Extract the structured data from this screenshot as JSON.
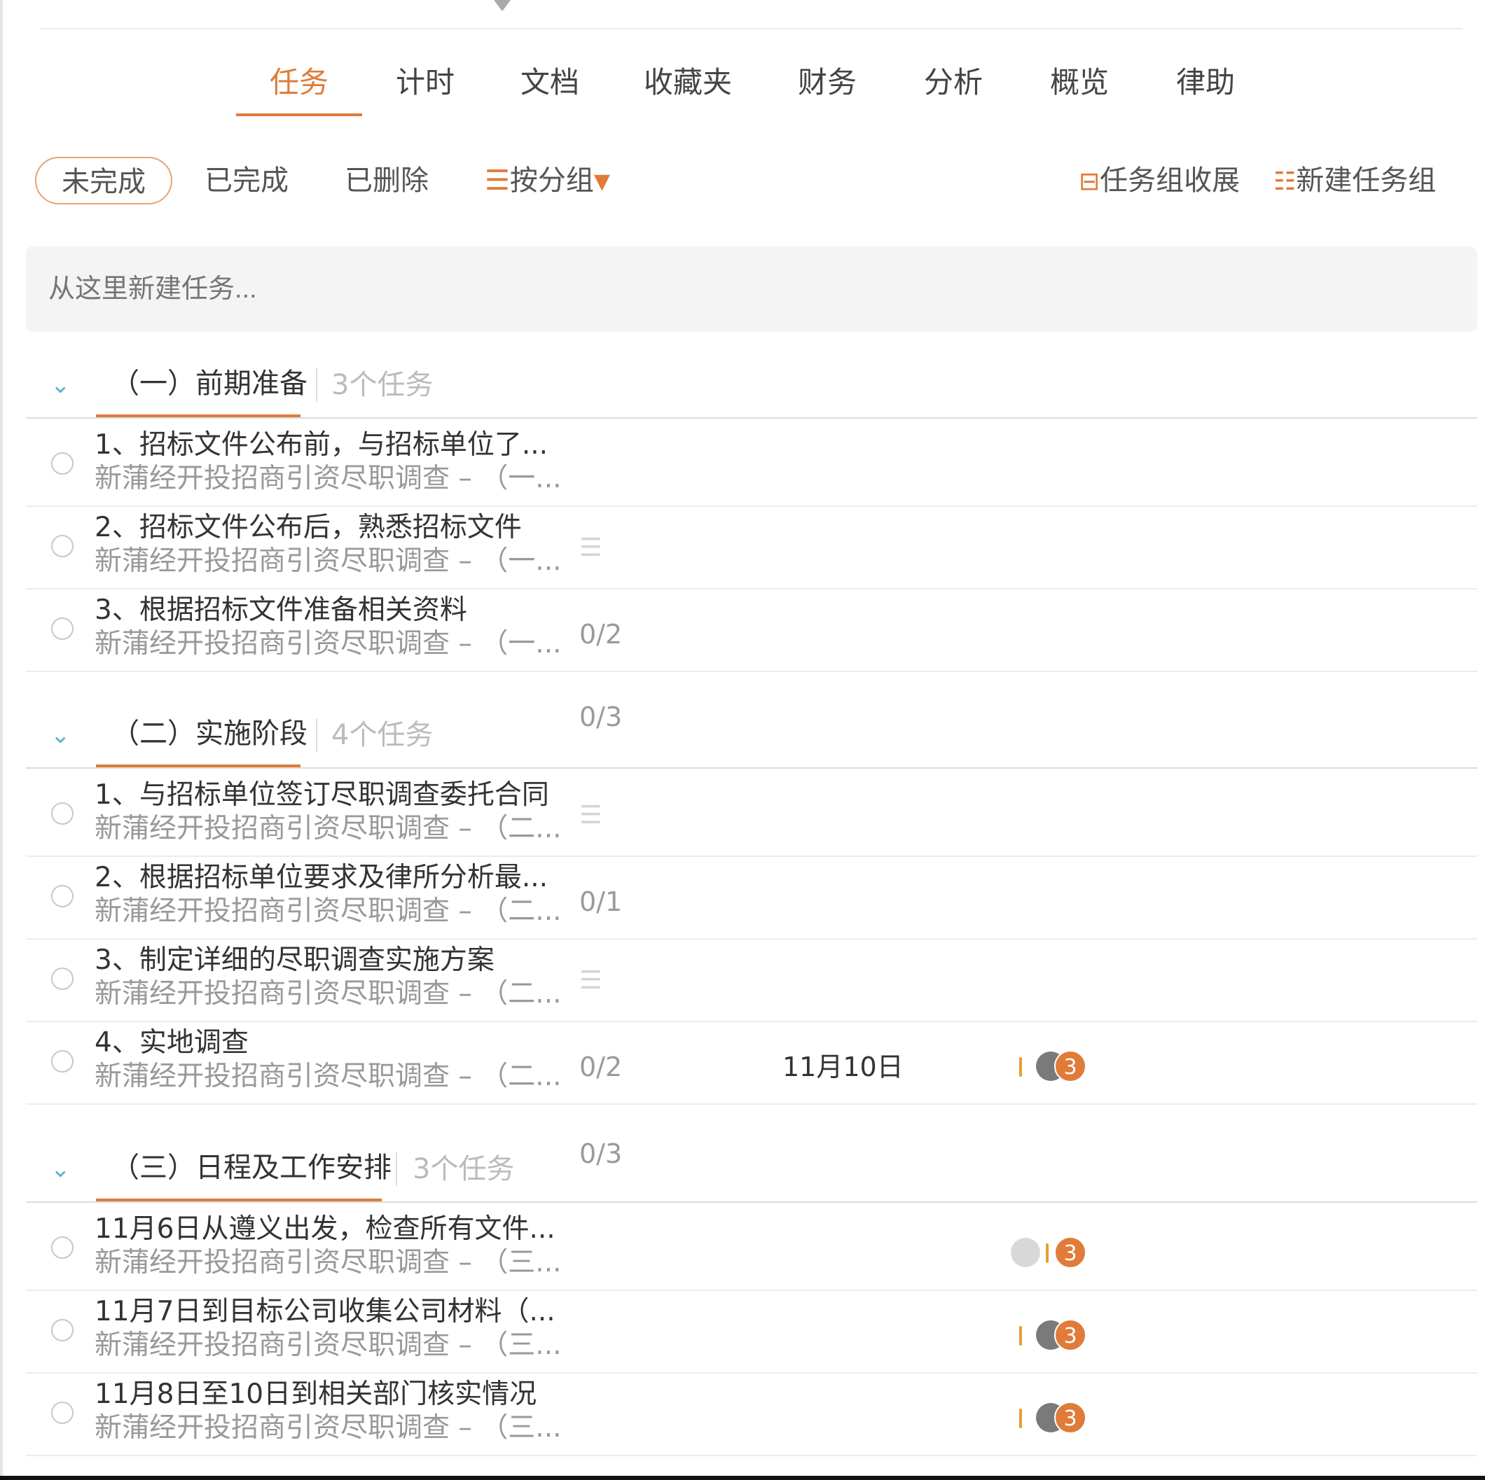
{
  "tabs": {
    "items": [
      "任务",
      "计时",
      "文档",
      "收藏夹",
      "财务",
      "分析",
      "概览",
      "律助"
    ]
  },
  "filters": {
    "incomplete": "未完成",
    "completed": "已完成",
    "deleted": "已删除",
    "group_by": "按分组",
    "collapse_groups": "任务组收展",
    "new_group": "新建任务组"
  },
  "new_task": {
    "placeholder": "从这里新建任务..."
  },
  "groups": [
    {
      "title": "（一）前期准备",
      "count": "3个任务",
      "tasks": [
        {
          "title": "1、招标文件公布前，与招标单位了...",
          "sub": "新蒲经开投招商引资尽职调查 – （一..."
        },
        {
          "title": "2、招标文件公布后，熟悉招标文件",
          "sub": "新蒲经开投招商引资尽职调查 – （一..."
        },
        {
          "title": "3、根据招标文件准备相关资料",
          "sub": "新蒲经开投招商引资尽职调查 – （一...",
          "subtasks": "0/2"
        }
      ]
    },
    {
      "title": "（二）实施阶段",
      "count": "4个任务",
      "header_subtasks": "0/3",
      "tasks": [
        {
          "title": "1、与招标单位签订尽职调查委托合同",
          "sub": "新蒲经开投招商引资尽职调查 – （二..."
        },
        {
          "title": "2、根据招标单位要求及律所分析最...",
          "sub": "新蒲经开投招商引资尽职调查 – （二...",
          "subtasks": "0/1"
        },
        {
          "title": "3、制定详细的尽职调查实施方案",
          "sub": "新蒲经开投招商引资尽职调查 – （二..."
        },
        {
          "title": "4、实地调查",
          "sub": "新蒲经开投招商引资尽职调查 – （二...",
          "subtasks": "0/2",
          "date": "11月10日",
          "badge": "3"
        }
      ]
    },
    {
      "title": "（三）日程及工作安排",
      "count": "3个任务",
      "header_subtasks": "0/3",
      "tasks": [
        {
          "title": "11月6日从遵义出发，检查所有文件...",
          "sub": "新蒲经开投招商引资尽职调查 – （三...",
          "badge": "3"
        },
        {
          "title": "11月7日到目标公司收集公司材料（...",
          "sub": "新蒲经开投招商引资尽职调查 – （三...",
          "badge": "3"
        },
        {
          "title": "11月8日至10日到相关部门核实情况",
          "sub": "新蒲经开投招商引资尽职调查 – （三...",
          "badge": "3"
        }
      ]
    }
  ],
  "colors": {
    "accent": "#e07b39",
    "chevron": "#5bb7c6"
  },
  "icons": {
    "group_by": "list-icon",
    "collapse": "collapse-icon",
    "new_group": "add-group-icon",
    "chevron": "chevron-down-icon",
    "subtask_list": "list-icon",
    "check": "circle-checkbox-icon"
  }
}
